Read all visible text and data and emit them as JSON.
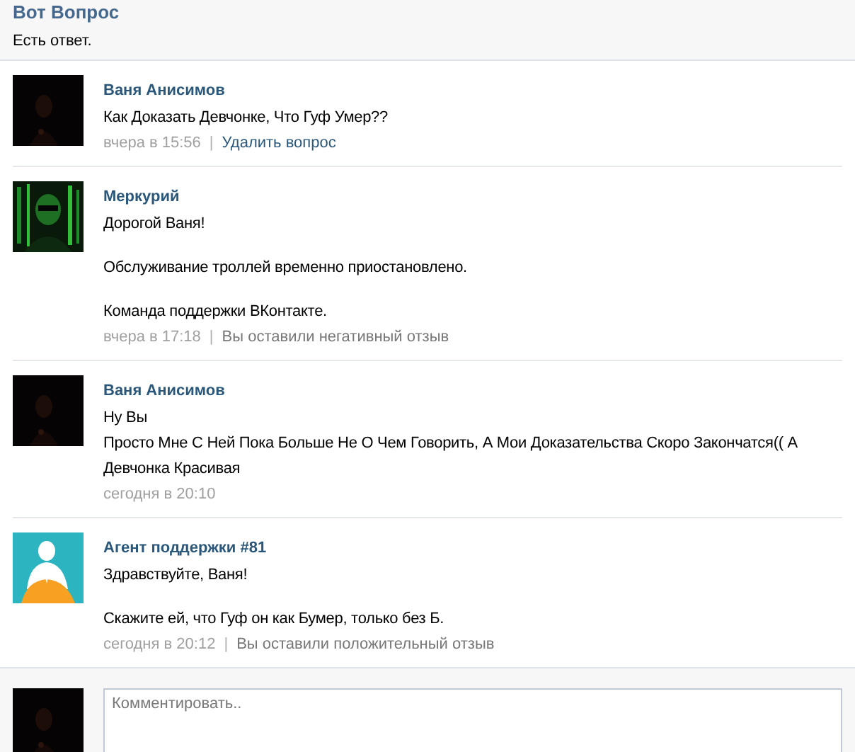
{
  "header": {
    "title": "Вот Вопрос",
    "status": "Есть ответ."
  },
  "posts": [
    {
      "author": "Ваня Анисимов",
      "paragraphs": [
        [
          "Как Доказать Девчонке, Что Гуф Умер??"
        ]
      ],
      "time": "вчера в 15:56",
      "action": {
        "kind": "link",
        "separator": "|",
        "text": "Удалить вопрос"
      }
    },
    {
      "author": "Меркурий",
      "paragraphs": [
        [
          "Дорогой Ваня!"
        ],
        [
          "Обслуживание троллей временно приостановлено."
        ],
        [
          "Команда поддержки ВКонтакте."
        ]
      ],
      "time": "вчера в 17:18",
      "action": {
        "kind": "note",
        "separator": "|",
        "text": "Вы оставили негативный отзыв"
      }
    },
    {
      "author": "Ваня Анисимов",
      "paragraphs": [
        [
          "Ну Вы",
          "Просто Мне С Ней Пока Больше Не О Чем Говорить, А Мои Доказательства Скоро Закончатся(( А",
          "Девчонка Красивая"
        ]
      ],
      "time": "сегодня в 20:10"
    },
    {
      "author": "Агент поддержки #81",
      "paragraphs": [
        [
          "Здравствуйте, Ваня!"
        ],
        [
          "Скажите ей, что Гуф он как Бумер, только без Б."
        ]
      ],
      "time": "сегодня в 20:12",
      "action": {
        "kind": "note",
        "separator": "|",
        "text": "Вы оставили положительный отзыв"
      }
    }
  ],
  "comment": {
    "placeholder": "Комментировать.."
  }
}
